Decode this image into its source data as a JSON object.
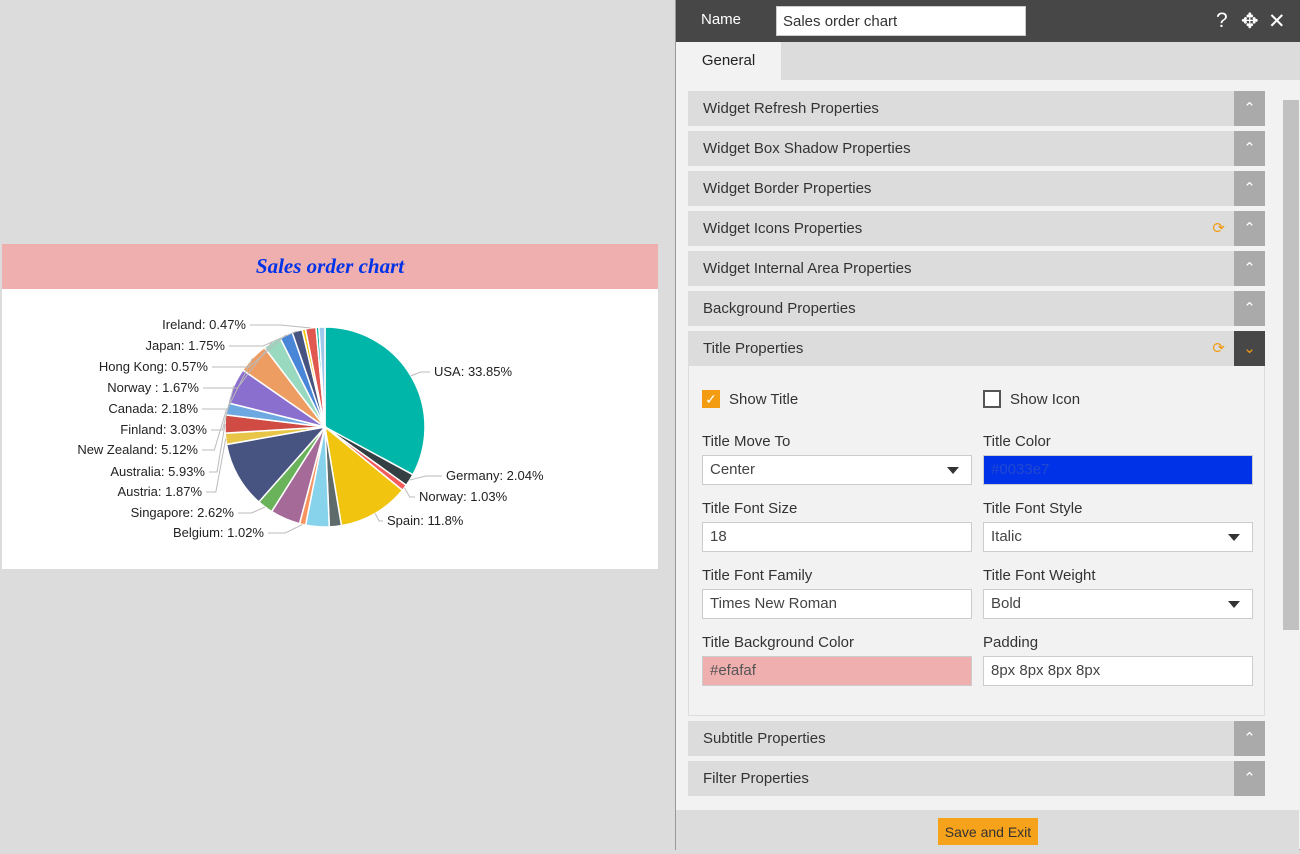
{
  "widget": {
    "title": "Sales order chart"
  },
  "chart_data": {
    "type": "pie",
    "title": "Sales order chart",
    "slices": [
      {
        "label": "USA: 33.85%",
        "value": 33.85,
        "color": "#00b6a8"
      },
      {
        "label": "Germany: 2.04%",
        "value": 2.04,
        "color": "#343f43"
      },
      {
        "label": "Norway: 1.03%",
        "value": 1.03,
        "color": "#f45b5b"
      },
      {
        "label": "Spain: 11.8%",
        "value": 11.8,
        "color": "#f1c40f"
      },
      {
        "label": null,
        "value": 2.0,
        "color": "#5f6a6a"
      },
      {
        "label": null,
        "value": 3.9,
        "color": "#87d3ec"
      },
      {
        "label": "Belgium: 1.02%",
        "value": 1.02,
        "color": "#f7945e"
      },
      {
        "label": null,
        "value": 5.0,
        "color": "#a66a99"
      },
      {
        "label": "Singapore: 2.62%",
        "value": 2.62,
        "color": "#6ab35a"
      },
      {
        "label": null,
        "value": 11.0,
        "color": "#475380"
      },
      {
        "label": "Austria: 1.87%",
        "value": 1.87,
        "color": "#e8c547"
      },
      {
        "label": "Australia: 5.93%",
        "value": 3.0,
        "color": "#cf4b43"
      },
      {
        "label": "New Zealand: 5.12%",
        "value": 2.0,
        "color": "#6ea8e0"
      },
      {
        "label": "Finland: 3.03%",
        "value": 5.93,
        "color": "#8a6fce"
      },
      {
        "label": "Canada: 2.18%",
        "value": 5.12,
        "color": "#ee9d62"
      },
      {
        "label": "Norway : 1.67%",
        "value": 3.03,
        "color": "#98d9c0"
      },
      {
        "label": "Hong Kong: 0.57%",
        "value": 2.18,
        "color": "#4a86d8"
      },
      {
        "label": "Japan: 1.75%",
        "value": 1.67,
        "color": "#475380"
      },
      {
        "label": null,
        "value": 0.57,
        "color": "#f1c40f"
      },
      {
        "label": "Ireland: 0.47%",
        "value": 1.75,
        "color": "#e0584f"
      },
      {
        "label": null,
        "value": 0.47,
        "color": "#00b6a8"
      },
      {
        "label": null,
        "value": 1.0,
        "color": "#9ec9ea"
      }
    ]
  },
  "panel": {
    "name_label": "Name",
    "name_value": "Sales order chart",
    "tab": "General",
    "sections_top": [
      "Widget Refresh Properties",
      "Widget Box Shadow Properties",
      "Widget Border Properties",
      "Widget Icons Properties",
      "Widget Internal Area Properties",
      "Background Properties",
      "Title Properties"
    ],
    "sections_bottom": [
      "Subtitle Properties",
      "Filter Properties"
    ],
    "title_props": {
      "show_title": "Show Title",
      "show_icon": "Show Icon",
      "move_to_label": "Title Move To",
      "move_to": "Center",
      "color_label": "Title Color",
      "color": "#0033e7",
      "size_label": "Title Font Size",
      "size": "18",
      "style_label": "Title Font Style",
      "style": "Italic",
      "family_label": "Title Font Family",
      "family": "Times New Roman",
      "weight_label": "Title Font Weight",
      "weight": "Bold",
      "bg_label": "Title Background Color",
      "bg": "#efafaf",
      "padding_label": "Padding",
      "padding": "8px 8px 8px 8px"
    },
    "save": "Save and Exit"
  }
}
